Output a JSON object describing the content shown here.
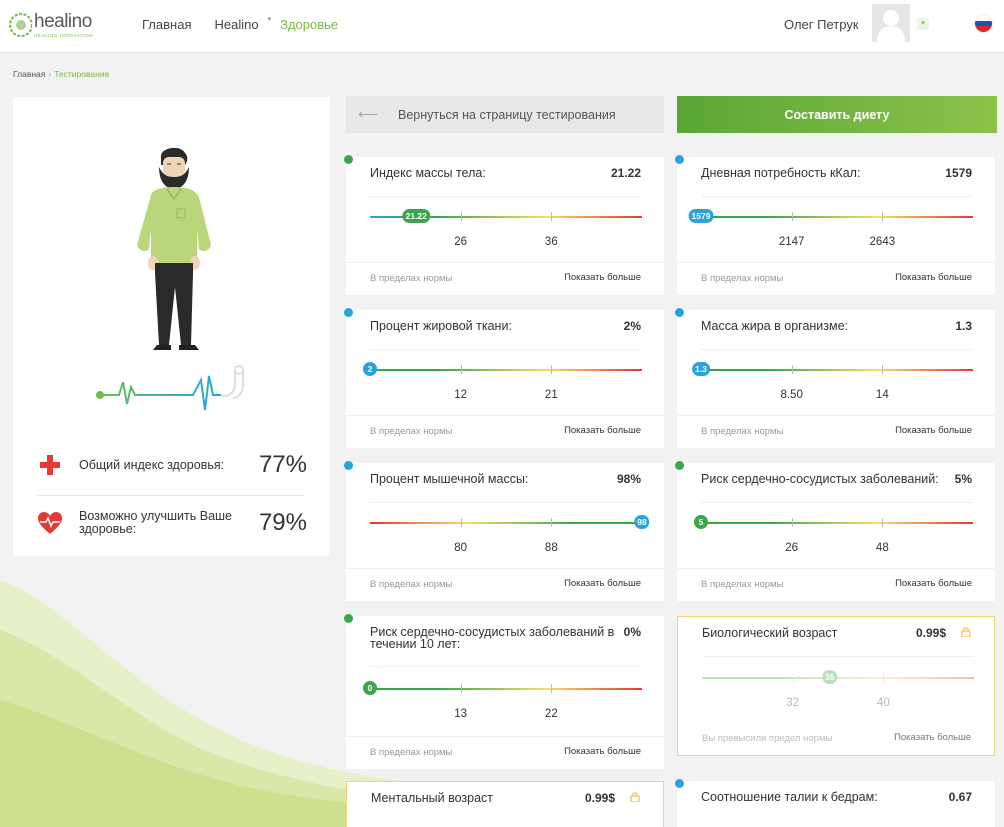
{
  "header": {
    "logo_text": "healino",
    "logo_sub": "HEALING INNOVATION",
    "nav": [
      {
        "label": "Главная"
      },
      {
        "label": "Healino"
      },
      {
        "label": "Здоровье"
      }
    ],
    "user_name": "Олег Петрук",
    "flag_colors": [
      "#ffffff",
      "#1e4fb5",
      "#e02828"
    ]
  },
  "breadcrumb": {
    "home": "Главная",
    "current": "Тестирование"
  },
  "summary": {
    "health_index_label": "Общий индекс здоровья:",
    "health_index_value": "77%",
    "improve_label": "Возможно улучшить Ваше здоровье:",
    "improve_value": "79%"
  },
  "actions": {
    "back_label": "Вернуться на страницу тестирования",
    "diet_label": "Составить диету"
  },
  "colors": {
    "accent_green": "#7ab648",
    "marker_green": "#3aa84a",
    "marker_blue": "#29a3dd",
    "lock_gold": "#f3c44a"
  },
  "metrics": [
    {
      "title": "Индекс массы тела:",
      "value": "21.22",
      "marker_label": "21.22",
      "marker_color": "green",
      "marker_pos": 0.17,
      "scale": "blue-green-yellow-red",
      "ticks": [
        "26",
        "36"
      ],
      "status": "В пределах нормы",
      "more": "Показать больше",
      "locked": false
    },
    {
      "title": "Дневная потребность кКал:",
      "value": "1579",
      "marker_label": "1579",
      "marker_color": "blue",
      "marker_pos": 0.0,
      "scale": "green-yellow-red",
      "ticks": [
        "2147",
        "2643"
      ],
      "status": "В пределах нормы",
      "more": "Показать больше",
      "locked": false
    },
    {
      "title": "Процент жировой ткани:",
      "value": "2%",
      "marker_label": "2",
      "marker_color": "blue",
      "marker_pos": 0.0,
      "scale": "green-yellow-red",
      "ticks": [
        "12",
        "21"
      ],
      "status": "В пределах нормы",
      "more": "Показать больше",
      "locked": false
    },
    {
      "title": "Масса жира в организме:",
      "value": "1.3",
      "marker_label": "1.3",
      "marker_color": "blue",
      "marker_pos": 0.0,
      "scale": "green-yellow-red",
      "ticks": [
        "8.50",
        "14"
      ],
      "status": "В пределах нормы",
      "more": "Показать больше",
      "locked": false
    },
    {
      "title": "Процент мышечной массы:",
      "value": "98%",
      "marker_label": "98",
      "marker_color": "blue",
      "marker_pos": 1.0,
      "scale": "red-yellow-green",
      "ticks": [
        "80",
        "88"
      ],
      "status": "В пределах нормы",
      "more": "Показать больше",
      "locked": false
    },
    {
      "title": "Риск сердечно-сосудистых заболеваний:",
      "value": "5%",
      "marker_label": "5",
      "marker_color": "green",
      "marker_pos": 0.0,
      "scale": "green-yellow-red",
      "ticks": [
        "26",
        "48"
      ],
      "status": "В пределах нормы",
      "more": "Показать больше",
      "locked": false
    },
    {
      "title": "Риск сердечно-сосудистых заболеваний в течении 10 лет:",
      "value": "0%",
      "marker_label": "0",
      "marker_color": "green",
      "marker_pos": 0.0,
      "scale": "green-yellow-red",
      "ticks": [
        "13",
        "22"
      ],
      "status": "В пределах нормы",
      "more": "Показать больше",
      "locked": false
    },
    {
      "title": "Биологический возраст",
      "value": "0.99$",
      "marker_label": "35",
      "marker_color": "green",
      "marker_pos": 0.47,
      "scale": "green-yellow-red",
      "ticks": [
        "32",
        "40"
      ],
      "status": "Вы превысили предел нормы",
      "more": "Показать больше",
      "locked": true
    },
    {
      "title": "Ментальный возраст",
      "value": "0.99$",
      "locked": true,
      "partial": true
    },
    {
      "title": "Соотношение талии к бедрам:",
      "value": "0.67",
      "locked": false,
      "partial": true
    }
  ]
}
